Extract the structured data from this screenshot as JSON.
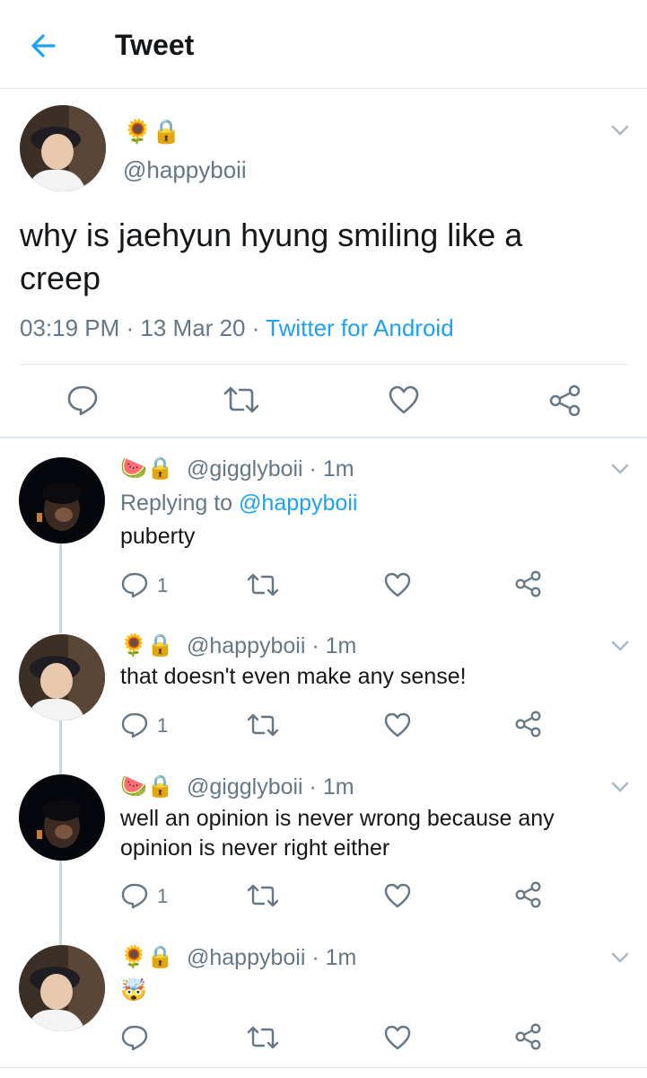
{
  "header": {
    "title": "Tweet"
  },
  "main_tweet": {
    "handle": "@happyboii",
    "emojis": "🌻🔒",
    "text": "why is jaehyun hyung smiling like a creep",
    "time": "03:19 PM",
    "dot1": " · ",
    "date": "13 Mar 20",
    "dot2": " · ",
    "source": "Twitter for Android"
  },
  "replies": [
    {
      "handle": "@gigglyboii · 1m",
      "emojis": "🍉🔒",
      "replying_label": "Replying to ",
      "replying_to": "@happyboii",
      "text": "puberty",
      "reply_count": "1"
    },
    {
      "handle": "@happyboii · 1m",
      "emojis": "🌻🔒",
      "text": "that doesn't even make any sense!",
      "reply_count": "1"
    },
    {
      "handle": "@gigglyboii · 1m",
      "emojis": "🍉🔒",
      "text": "well an opinion is never wrong because any opinion is never right either",
      "reply_count": "1"
    },
    {
      "handle": "@happyboii · 1m",
      "emojis": "🌻🔒",
      "text": "🤯",
      "reply_count": ""
    }
  ],
  "colors": {
    "accent": "#1da1f2",
    "muted": "#657786",
    "text": "#14171a",
    "divider": "#e1e8ed"
  }
}
